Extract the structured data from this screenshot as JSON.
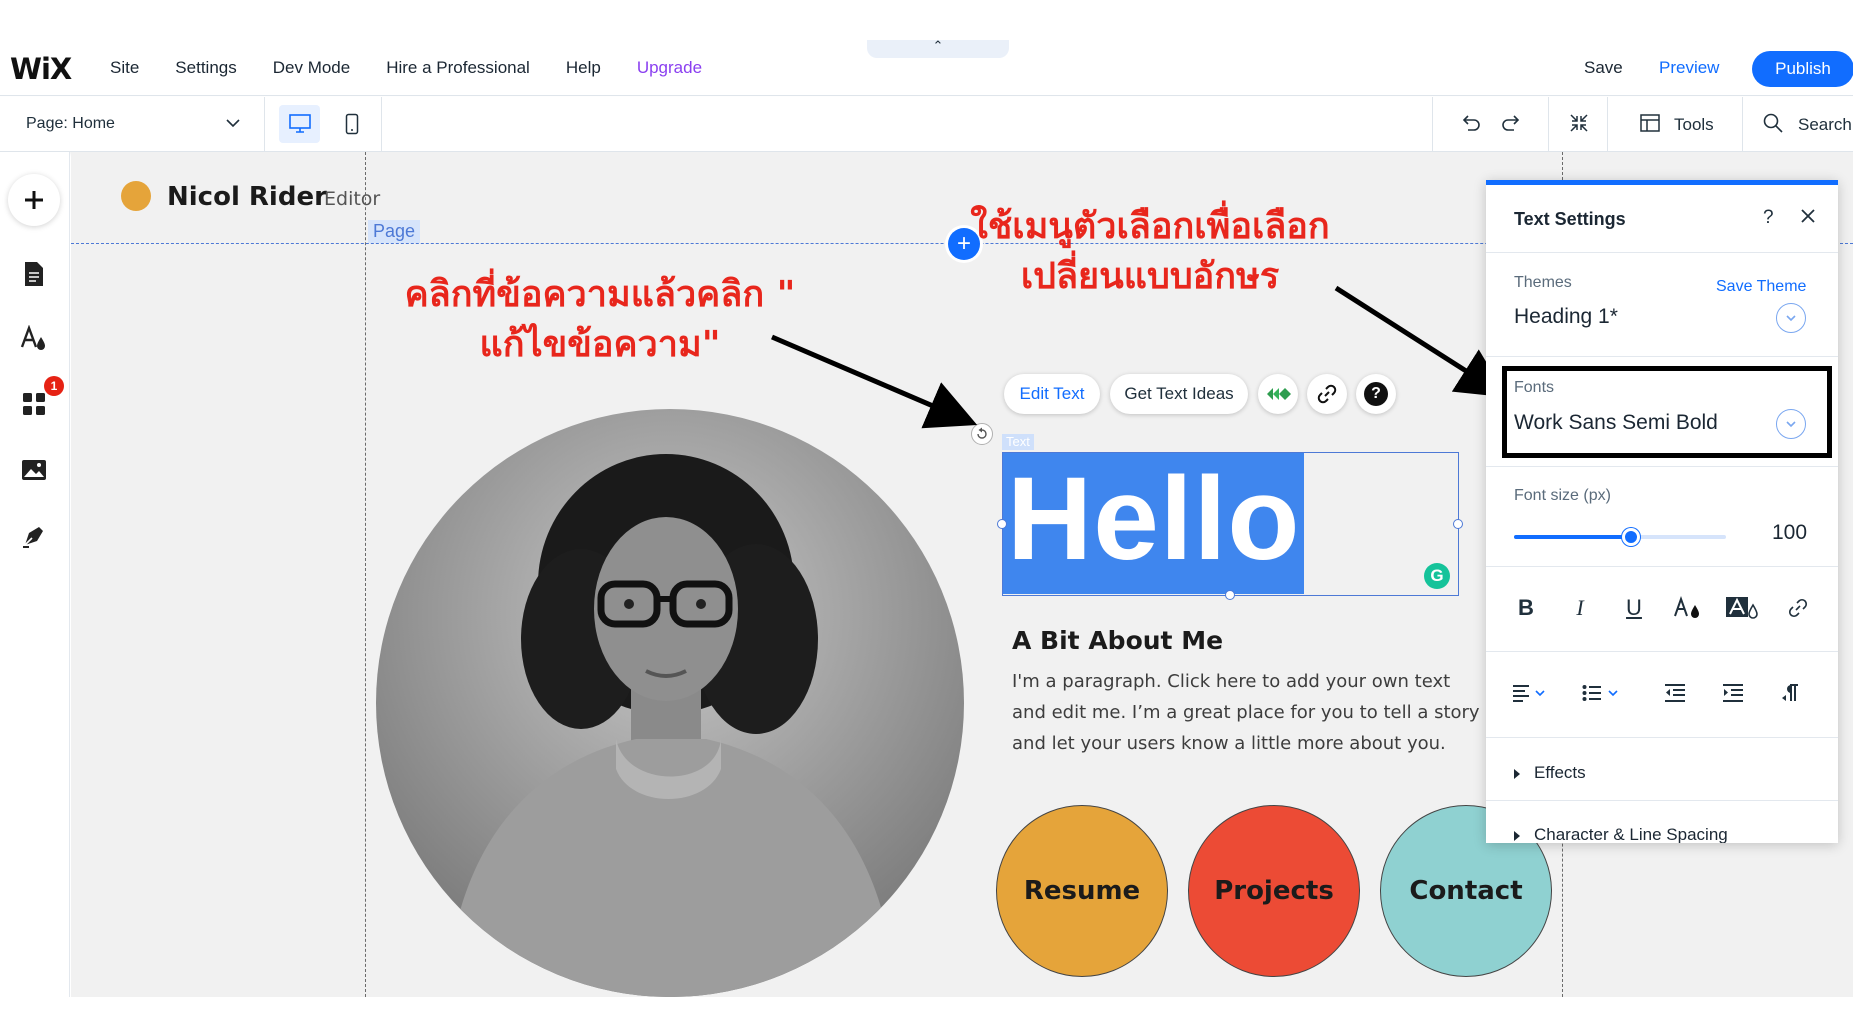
{
  "topbar": {
    "logo": "WiX",
    "nav": [
      "Site",
      "Settings",
      "Dev Mode",
      "Hire a Professional",
      "Help",
      "Upgrade"
    ],
    "collapse_glyph": "⌃",
    "save": "Save",
    "preview": "Preview",
    "publish": "Publish"
  },
  "toolbar": {
    "page_label": "Page:",
    "page_value": "Home",
    "tools": "Tools",
    "search": "Search"
  },
  "leftrail": {
    "icons": [
      "add-icon",
      "pages-icon",
      "design-icon",
      "apps-icon",
      "media-icon",
      "blog-icon"
    ],
    "apps_badge": "1"
  },
  "canvas": {
    "brand_name": "Nicol Rider",
    "brand_role": "Editor",
    "page_tag": "Page",
    "add_section": "+",
    "edit_toolbar": {
      "edit_text": "Edit Text",
      "get_text_ideas": "Get Text Ideas",
      "help": "?"
    },
    "text_tag": "Text",
    "hello": "Hello",
    "grammarly": "G",
    "about_title": "A Bit About Me",
    "about_body": "I'm a paragraph. Click here to add your own text and edit me. I’m a great place for you to tell a story and let your users know a little more about you.",
    "buttons": [
      {
        "label": "Resume",
        "color": "#e5a43a"
      },
      {
        "label": "Projects",
        "color": "#ec4b35"
      },
      {
        "label": "Contact",
        "color": "#8fd1d1"
      }
    ]
  },
  "annotations": {
    "left": "คลิกที่ข้อความแล้วคลิก \" แก้ไขข้อความ\"",
    "right": "ใช้เมนูตัวเลือกเพื่อเลือก เปลี่ยนแบบอักษร"
  },
  "panel": {
    "title": "Text Settings",
    "help": "?",
    "themes_label": "Themes",
    "save_theme": "Save Theme",
    "theme_value": "Heading 1*",
    "fonts_label": "Fonts",
    "font_value": "Work Sans Semi Bold",
    "font_size_label": "Font size (px)",
    "font_size_value": "100",
    "font_size_fraction": 0.55,
    "format_buttons": [
      "B",
      "I",
      "U"
    ],
    "effects": "Effects",
    "char_spacing": "Character & Line Spacing"
  },
  "colors": {
    "accent": "#116dff",
    "upgrade": "#8a3ff0",
    "annotation": "#e8261c",
    "selection": "#3f86ee"
  }
}
